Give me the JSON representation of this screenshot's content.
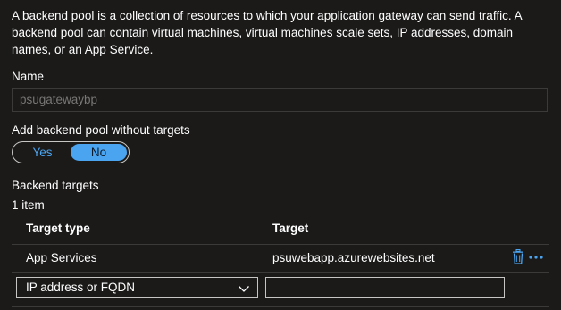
{
  "description": "A backend pool is a collection of resources to which your application gateway can send traffic. A backend pool can contain virtual machines, virtual machines scale sets, IP addresses, domain names, or an App Service.",
  "name_field": {
    "label": "Name",
    "value": "psugatewaybp"
  },
  "without_targets": {
    "label": "Add backend pool without targets",
    "options": [
      "Yes",
      "No"
    ],
    "selected": "No"
  },
  "backend_targets": {
    "heading": "Backend targets",
    "count": "1 item",
    "columns": {
      "target_type": "Target type",
      "target": "Target"
    },
    "rows": [
      {
        "target_type": "App Services",
        "target": "psuwebapp.azurewebsites.net"
      }
    ],
    "new_row": {
      "type_selected": "IP address or FQDN",
      "target_value": ""
    }
  },
  "colors": {
    "accent": "#4aa4f0",
    "background": "#1b1a19"
  },
  "icons": {
    "delete": "trash-icon",
    "more": "ellipsis-icon",
    "dropdown": "chevron-down-icon"
  }
}
